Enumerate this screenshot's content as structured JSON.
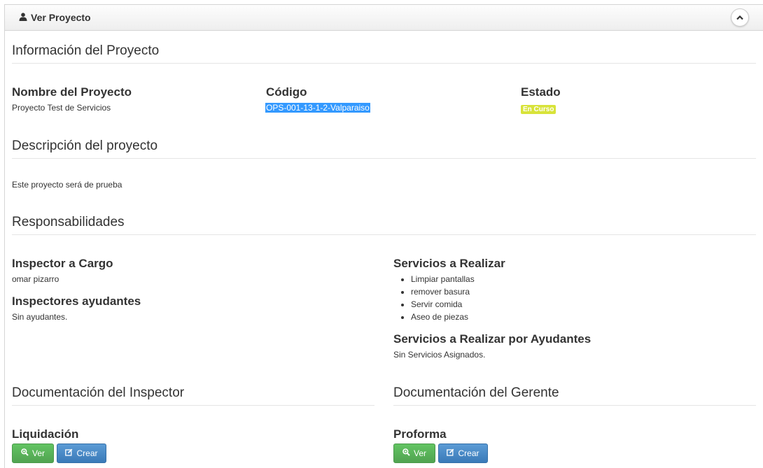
{
  "header": {
    "title": "Ver Proyecto"
  },
  "info": {
    "section_title": "Información del Proyecto",
    "nombre_label": "Nombre del Proyecto",
    "nombre_value": "Proyecto Test de Servicios",
    "codigo_label": "Código",
    "codigo_value": "OPS-001-13-1-2-Valparaiso",
    "estado_label": "Estado",
    "estado_value": "En Curso",
    "estado_color": "#d8e33a"
  },
  "descripcion": {
    "section_title": "Descripción del proyecto",
    "text": "Este proyecto será de prueba"
  },
  "responsabilidades": {
    "section_title": "Responsabilidades",
    "inspector_label": "Inspector a Cargo",
    "inspector_value": "omar pizarro",
    "ayudantes_label": "Inspectores ayudantes",
    "ayudantes_value": "Sin ayudantes.",
    "servicios_label": "Servicios a Realizar",
    "servicios": [
      "Limpiar pantallas",
      "remover basura",
      "Servir comida",
      "Aseo de piezas"
    ],
    "servicios_ayudantes_label": "Servicios a Realizar por Ayudantes",
    "servicios_ayudantes_value": "Sin Servicios Asignados."
  },
  "doc_inspector": {
    "section_title": "Documentación del Inspector",
    "item_label": "Liquidación",
    "ver_label": "Ver",
    "crear_label": "Crear"
  },
  "doc_gerente": {
    "section_title": "Documentación del Gerente",
    "item_label": "Proforma",
    "ver_label": "Ver",
    "crear_label": "Crear"
  },
  "colors": {
    "ver_button": "#5bb75b",
    "crear_button": "#4a8bc6",
    "selection": "#3399ff"
  },
  "icons": [
    "user-icon",
    "chevron-up-icon",
    "zoom-in-icon",
    "edit-icon"
  ]
}
